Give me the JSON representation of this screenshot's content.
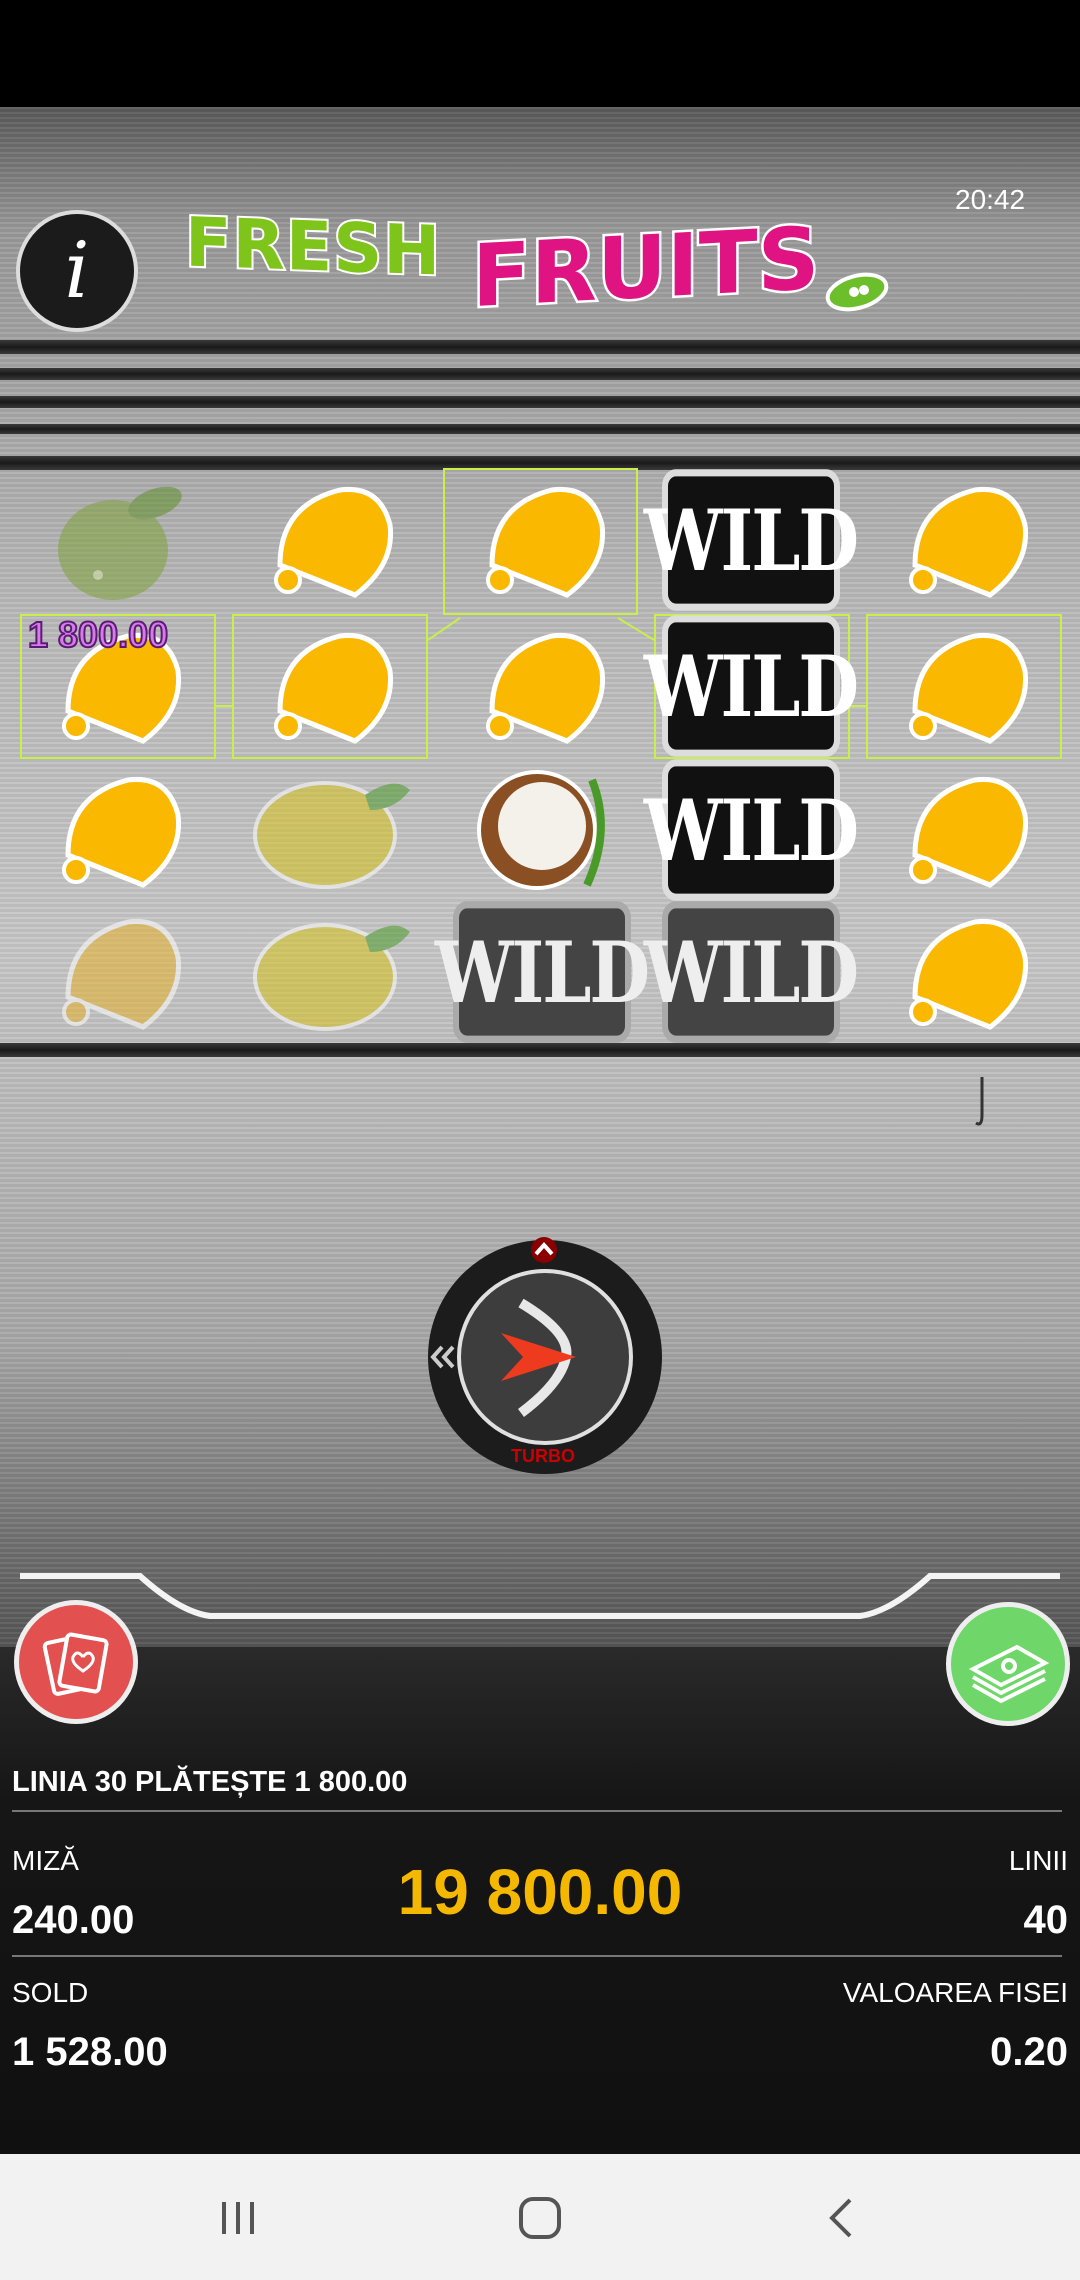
{
  "status": {
    "time": "20:42"
  },
  "header": {
    "logo_word1": "FRESH",
    "logo_word2": "FRUITS",
    "info_icon": "i"
  },
  "reels": {
    "grid": [
      [
        "apple",
        "bell",
        "bell",
        "wild",
        "bell"
      ],
      [
        "bell",
        "bell",
        "bell",
        "wild",
        "bell"
      ],
      [
        "bell",
        "lemon",
        "coconut",
        "wild",
        "bell"
      ],
      [
        "bell",
        "lemon",
        "wild",
        "wild",
        "bell"
      ]
    ],
    "wild_label": "WILD",
    "win_amount_label": "1 800.00"
  },
  "controls": {
    "turbo_label": "TURBO",
    "spin_icon": "spin-arrow-icon",
    "rewind_icon": "double-chevron-left-icon",
    "autoplay_icon": "chevron-up-icon"
  },
  "panel": {
    "win_line_text": "LINIA 30 PLĂTEȘTE 1 800.00",
    "bet_label": "MIZĂ",
    "bet_value": "240.00",
    "total_win": "19 800.00",
    "lines_label": "LINII",
    "lines_value": "40",
    "balance_label": "SOLD",
    "balance_value": "1 528.00",
    "coin_value_label": "VALOAREA FISEI",
    "coin_value": "0.20"
  },
  "colors": {
    "highlight": "#c9ef4a",
    "win_total": "#f5b800",
    "bell": "#fbb800",
    "fresh": "#7fc41a",
    "fruits": "#e01383"
  }
}
